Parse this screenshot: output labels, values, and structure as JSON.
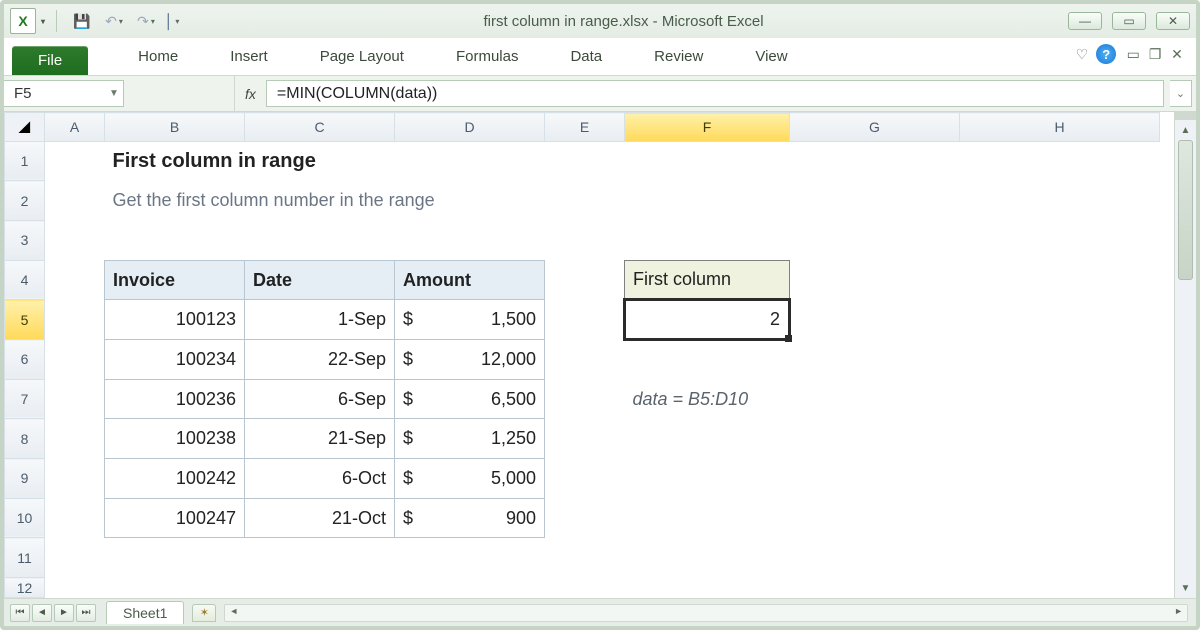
{
  "title": "first column in range.xlsx  -  Microsoft Excel",
  "ribbon": {
    "file": "File",
    "tabs": [
      "Home",
      "Insert",
      "Page Layout",
      "Formulas",
      "Data",
      "Review",
      "View"
    ]
  },
  "namebox": "F5",
  "fx_label": "fx",
  "formula": "=MIN(COLUMN(data))",
  "columns": [
    "A",
    "B",
    "C",
    "D",
    "E",
    "F",
    "G",
    "H"
  ],
  "rows": [
    "1",
    "2",
    "3",
    "4",
    "5",
    "6",
    "7",
    "8",
    "9",
    "10",
    "11",
    "12"
  ],
  "active_col": "F",
  "active_row": "5",
  "content": {
    "title": "First column in range",
    "subtitle": "Get the first column number in the range",
    "headers": {
      "invoice": "Invoice",
      "date": "Date",
      "amount": "Amount"
    },
    "table": [
      {
        "invoice": "100123",
        "date": "1-Sep",
        "cur": "$",
        "amount": "1,500"
      },
      {
        "invoice": "100234",
        "date": "22-Sep",
        "cur": "$",
        "amount": "12,000"
      },
      {
        "invoice": "100236",
        "date": "6-Sep",
        "cur": "$",
        "amount": "6,500"
      },
      {
        "invoice": "100238",
        "date": "21-Sep",
        "cur": "$",
        "amount": "1,250"
      },
      {
        "invoice": "100242",
        "date": "6-Oct",
        "cur": "$",
        "amount": "5,000"
      },
      {
        "invoice": "100247",
        "date": "21-Oct",
        "cur": "$",
        "amount": "900"
      }
    ],
    "first_col_label": "First column",
    "first_col_value": "2",
    "note": "data = B5:D10"
  },
  "sheet": {
    "name": "Sheet1"
  }
}
